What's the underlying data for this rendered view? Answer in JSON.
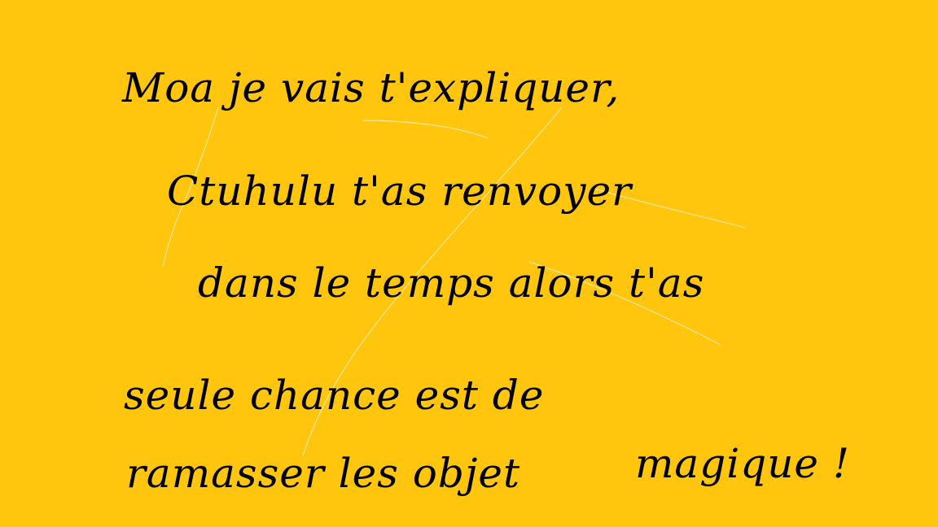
{
  "colors": {
    "background": "#FFC60D",
    "text": "#000000",
    "scribble": "#FFE8A0"
  },
  "lines": [
    "Moa je vais t'expliquer,",
    "Ctuhulu t'as renvoyer",
    "dans le temps alors t'as",
    "seule chance est de",
    "ramasser les objet",
    "magique !"
  ]
}
